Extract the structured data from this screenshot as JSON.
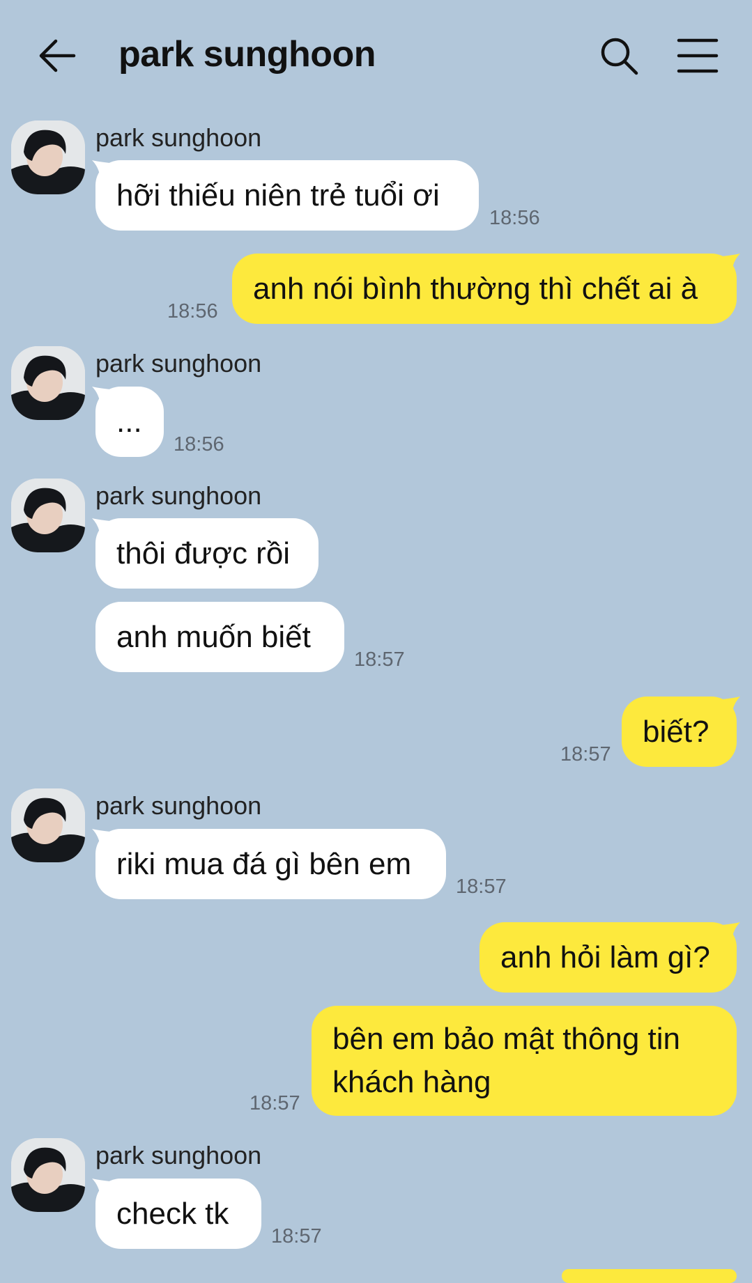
{
  "header": {
    "title": "park sunghoon",
    "back_icon": "arrow-left-icon",
    "search_icon": "search-icon",
    "menu_icon": "hamburger-menu-icon"
  },
  "colors": {
    "background": "#b2c7da",
    "incoming_bubble": "#ffffff",
    "outgoing_bubble": "#fde93d",
    "timestamp": "#5e6670"
  },
  "messages": [
    {
      "sender": "park sunghoon",
      "text": "hỡi thiếu niên trẻ tuổi ơi",
      "time": "18:56"
    },
    {
      "text": "anh nói bình thường thì chết ai à",
      "time": "18:56"
    },
    {
      "sender": "park sunghoon",
      "text": "...",
      "time": "18:56"
    },
    {
      "sender": "park sunghoon",
      "text": "thôi được rồi"
    },
    {
      "text": "anh muốn biết",
      "time": "18:57"
    },
    {
      "text": "biết?",
      "time": "18:57"
    },
    {
      "sender": "park sunghoon",
      "text": "riki mua đá gì bên em",
      "time": "18:57"
    },
    {
      "text": "anh hỏi làm gì?"
    },
    {
      "text": "bên em bảo mật thông tin khách hàng",
      "time": "18:57"
    },
    {
      "sender": "park sunghoon",
      "text": "check tk",
      "time": "18:57"
    }
  ]
}
